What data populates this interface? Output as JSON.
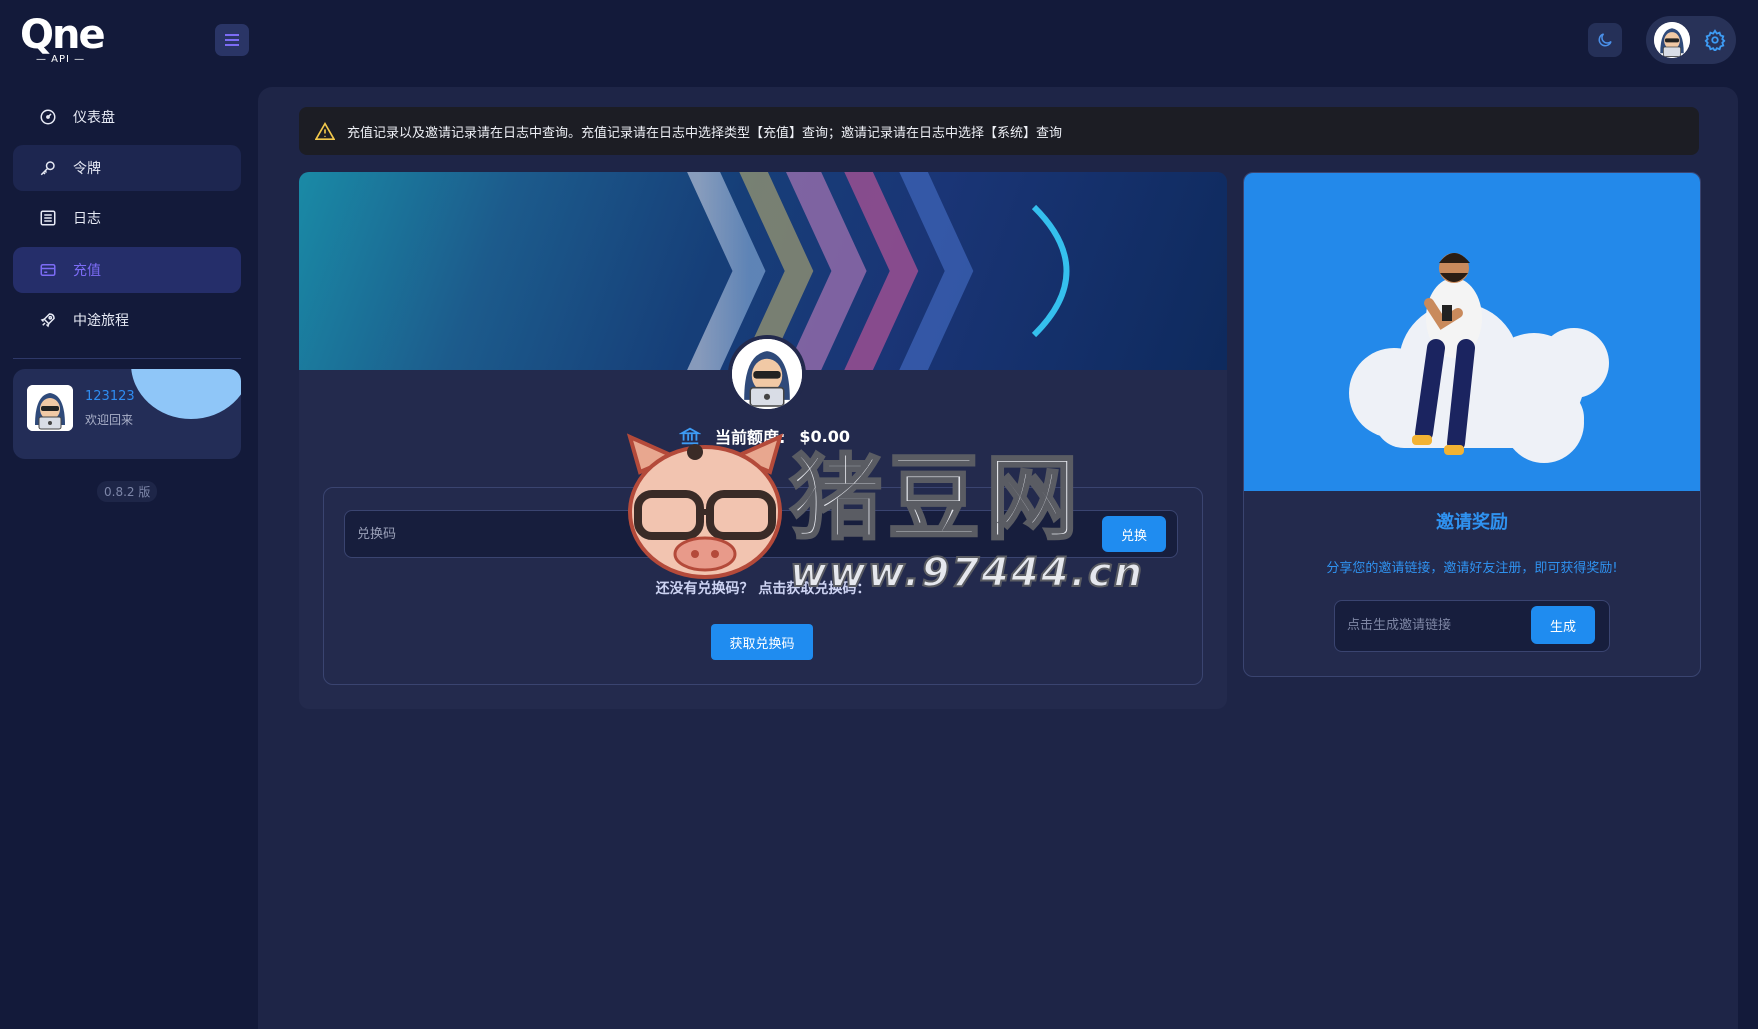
{
  "brand": {
    "logo_text": "Qne",
    "logo_sub": "— API —"
  },
  "sidebar": {
    "items": [
      {
        "label": "仪表盘",
        "icon": "dashboard-icon"
      },
      {
        "label": "令牌",
        "icon": "key-icon"
      },
      {
        "label": "日志",
        "icon": "list-icon"
      },
      {
        "label": "充值",
        "icon": "wallet-icon"
      },
      {
        "label": "中途旅程",
        "icon": "rocket-icon"
      }
    ],
    "active_index": 3,
    "user": {
      "name": "123123",
      "welcome": "欢迎回来"
    },
    "version": "0.8.2 版"
  },
  "alert": {
    "text": "充值记录以及邀请记录请在日志中查询。充值记录请在日志中选择类型【充值】查询；邀请记录请在日志中选择【系统】查询"
  },
  "redeem": {
    "balance_label": "当前额度:",
    "balance_value": "$0.00",
    "input_placeholder": "兑换码",
    "redeem_button": "兑换",
    "no_code_text": "还没有兑换码？ 点击获取兑换码：",
    "get_code_button": "获取兑换码"
  },
  "invite": {
    "title": "邀请奖励",
    "desc": "分享您的邀请链接，邀请好友注册，即可获得奖励!",
    "input_placeholder": "点击生成邀请链接",
    "generate_button": "生成"
  },
  "watermark": {
    "title": "猪豆网",
    "url": "www.97444.cn"
  },
  "colors": {
    "accent": "#1f8cf0",
    "active_nav": "#7c6cf5",
    "background": "#131a3a",
    "panel": "#232a4d"
  }
}
